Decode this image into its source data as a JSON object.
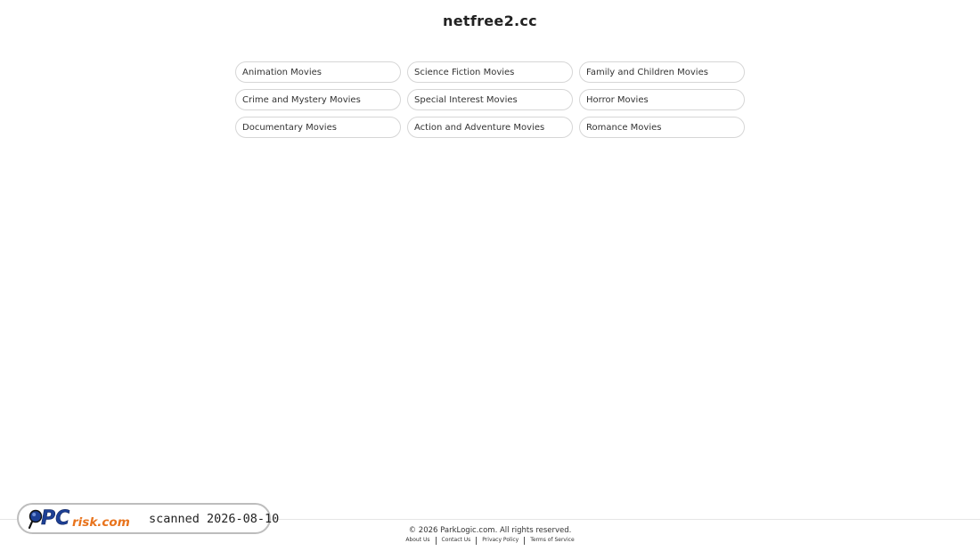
{
  "site": {
    "title": "netfree2.cc"
  },
  "categories": [
    {
      "label": "Animation Movies"
    },
    {
      "label": "Science Fiction Movies"
    },
    {
      "label": "Family and Children Movies"
    },
    {
      "label": "Crime and Mystery Movies"
    },
    {
      "label": "Special Interest Movies"
    },
    {
      "label": "Horror Movies"
    },
    {
      "label": "Documentary Movies"
    },
    {
      "label": "Action and Adventure Movies"
    },
    {
      "label": "Romance Movies"
    }
  ],
  "footer": {
    "copyright": "© 2026 ParkLogic.com. All rights reserved.",
    "links": [
      {
        "label": "About Us"
      },
      {
        "label": "Contact Us"
      },
      {
        "label": "Privacy Policy"
      },
      {
        "label": "Terms of Service"
      }
    ]
  },
  "watermark": {
    "logo_text": "PCrisk.com",
    "scan_text": "scanned 2026-08-10",
    "colors": {
      "logo_blue": "#1c3f94",
      "logo_orange": "#e8731c"
    }
  }
}
